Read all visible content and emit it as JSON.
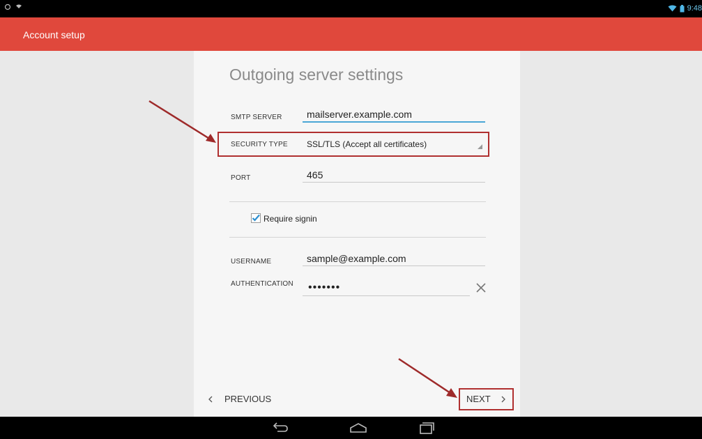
{
  "statusbar": {
    "time": "9:48",
    "icons": [
      "circle-icon",
      "notification-icon",
      "wifi-icon",
      "battery-icon"
    ]
  },
  "appbar": {
    "title": "Account setup"
  },
  "page": {
    "heading": "Outgoing server settings",
    "smtp_label": "SMTP SERVER",
    "smtp_value": "mailserver.example.com",
    "security_label": "SECURITY TYPE",
    "security_value": "SSL/TLS (Accept all certificates)",
    "port_label": "PORT",
    "port_value": "465",
    "require_signin_label": "Require signin",
    "require_signin_checked": true,
    "username_label": "USERNAME",
    "username_value": "sample@example.com",
    "auth_label": "AUTHENTICATION",
    "auth_value": "•••••••"
  },
  "footer": {
    "previous_label": "PREVIOUS",
    "previous_icon": "chevron-left-icon",
    "next_label": "NEXT",
    "next_icon": "chevron-right-icon"
  },
  "navbar": {
    "icons": [
      "back-icon",
      "home-icon",
      "recents-icon"
    ]
  },
  "colors": {
    "appbar": "#e0483c",
    "annotation": "#b03030",
    "accent": "#4aa6d6"
  }
}
